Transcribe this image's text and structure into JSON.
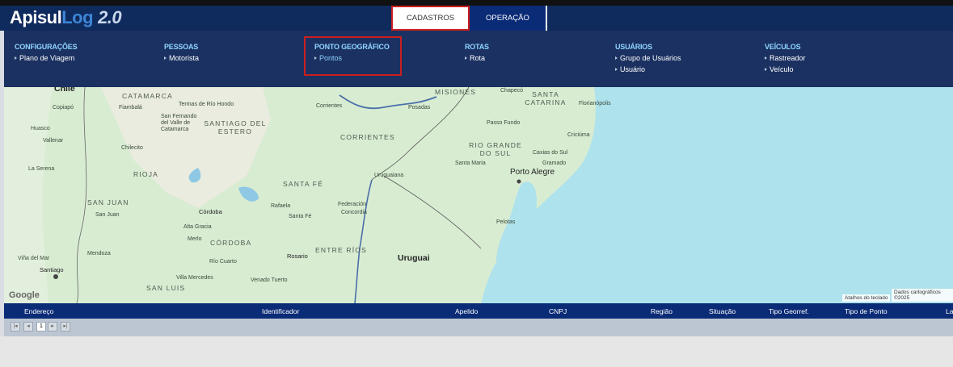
{
  "app": {
    "logo_main": "Apisul",
    "logo_accent": "Log",
    "logo_version": "2.0"
  },
  "tabs": {
    "cadastros": "CADASTROS",
    "operacao": "OPERAÇÃO"
  },
  "menu": {
    "configuracoes": {
      "title": "CONFIGURAÇÕES",
      "items": [
        "Plano de Viagem"
      ]
    },
    "pessoas": {
      "title": "PESSOAS",
      "items": [
        "Motorista"
      ]
    },
    "ponto": {
      "title": "PONTO GEOGRÁFICO",
      "items": [
        "Pontos"
      ]
    },
    "rotas": {
      "title": "ROTAS",
      "items": [
        "Rota"
      ]
    },
    "usuarios": {
      "title": "USUÁRIOS",
      "items": [
        "Grupo de Usuários",
        "Usuário"
      ]
    },
    "veiculos": {
      "title": "VEÍCULOS",
      "items": [
        "Rastreador",
        "Veículo"
      ]
    }
  },
  "map": {
    "labels": {
      "chile": "Chile",
      "copiapo": "Copiapó",
      "huasco": "Huasco",
      "vallenar": "Vallenar",
      "la_serena": "La Serena",
      "vina": "Viña del Mar",
      "santiago": "Santiago",
      "catamarca": "CATAMARCA",
      "fiambala": "Fiambalá",
      "termas": "Termas de Río Hondo",
      "sfv": "San Fernando del Valle de Catamarca",
      "santiago_estero": "SANTIAGO DEL ESTERO",
      "chilecito": "Chilecito",
      "rioja": "RIOJA",
      "san_juan_prov": "SAN JUAN",
      "san_juan": "San Juan",
      "mendoza": "Mendoza",
      "san_luis": "SAN LUIS",
      "cordoba": "Córdoba",
      "alta_gracia": "Alta Gracia",
      "merlo": "Merlo",
      "cordoba_prov": "CÓRDOBA",
      "rio_cuarto": "Río Cuarto",
      "villa_mercedes": "Villa Mercedes",
      "venado": "Venado Tuerto",
      "santa_fe_prov": "SANTA FÉ",
      "rafaela": "Rafaela",
      "santa_fe": "Santa Fé",
      "rosario": "Rosario",
      "corrientes_city": "Corrientes",
      "corrientes": "CORRIENTES",
      "posadas": "Posadas",
      "misiones": "MISIONES",
      "uruguaiana": "Uruguaiana",
      "federacion": "Federación",
      "concordia": "Concordia",
      "entre_rios": "ENTRE RÍOS",
      "uruguai": "Uruguai",
      "chapeco": "Chapecó",
      "santa_catarina": "SANTA CATARINA",
      "florianopolis": "Florianópolis",
      "passo_fundo": "Passo Fundo",
      "criciuma": "Criciúma",
      "rio_grande": "RIO GRANDE DO SUL",
      "caxias": "Caxias do Sul",
      "santa_maria": "Santa Maria",
      "gramado": "Gramado",
      "porto_alegre": "Porto Alegre",
      "pelotas": "Pelotas"
    },
    "google": "Google",
    "shortcuts": "Atalhos do teclado",
    "mapdata": "Dados cartográficos ©2025"
  },
  "grid": {
    "columns": [
      "Endereço",
      "Identificador",
      "Apelido",
      "CNPJ",
      "Região",
      "Situação",
      "Tipo Georref.",
      "Tipo de Ponto",
      "La"
    ],
    "page": "1"
  },
  "colors": {
    "navy": "#0f2a5c",
    "menu_bg": "#1b3161",
    "accent": "#8fd5ff",
    "highlight": "#cc1f1f",
    "land": "#d8ecd2",
    "water": "#aee2ec"
  }
}
